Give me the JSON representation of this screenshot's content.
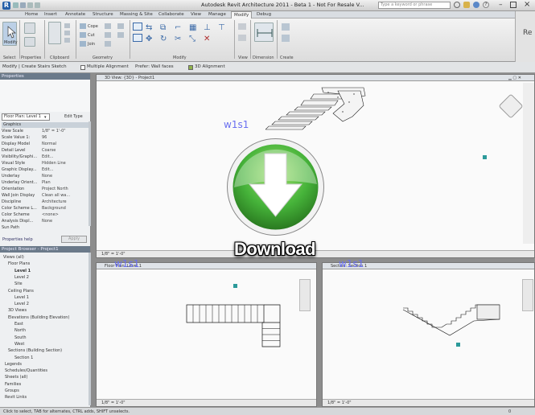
{
  "app": {
    "title": "Autodesk Revit Architecture 2011 - Beta 1 - Not For Resale V...",
    "search_placeholder": "Type a keyword or phrase",
    "right_button": "Re"
  },
  "tabs": [
    "Home",
    "Insert",
    "Annotate",
    "Structure",
    "Massing & Site",
    "Collaborate",
    "View",
    "Manage",
    "Modify",
    "Debug"
  ],
  "ribbon": {
    "panels": [
      "Select",
      "Properties",
      "Clipboard",
      "Geometry",
      "Modify",
      "View",
      "Dimension",
      "Create"
    ],
    "button_labels": [
      "Modify",
      "Cope",
      "Cut",
      "Join"
    ]
  },
  "optbar": {
    "items": [
      "Modify | Create Stairs Sketch",
      "Multiple Alignment",
      "Prefer: Wall faces",
      "3D Alignment"
    ]
  },
  "properties": {
    "header": "Properties",
    "type_selector": "Floor Plan: Level 1",
    "edit_type": "Edit Type",
    "section": "Graphics",
    "rows": [
      {
        "k": "View Scale",
        "v": "1/8\" = 1'-0\""
      },
      {
        "k": "Scale Value 1:",
        "v": "96"
      },
      {
        "k": "Display Model",
        "v": "Normal"
      },
      {
        "k": "Detail Level",
        "v": "Coarse"
      },
      {
        "k": "Visibility/Graphi...",
        "v": "Edit..."
      },
      {
        "k": "Visual Style",
        "v": "Hidden Line"
      },
      {
        "k": "Graphic Display...",
        "v": "Edit..."
      },
      {
        "k": "Underlay",
        "v": "None"
      },
      {
        "k": "Underlay Orient...",
        "v": "Plan"
      },
      {
        "k": "Orientation",
        "v": "Project North"
      },
      {
        "k": "Wall Join Display",
        "v": "Clean all wa..."
      },
      {
        "k": "Discipline",
        "v": "Architecture"
      },
      {
        "k": "Color Scheme L...",
        "v": "Background"
      },
      {
        "k": "Color Scheme",
        "v": "<none>"
      },
      {
        "k": "Analysis Displ...",
        "v": "None"
      },
      {
        "k": "Sun Path",
        "v": ""
      }
    ],
    "help_link": "Properties help",
    "apply": "Apply"
  },
  "browser": {
    "header": "Project Browser - Project1",
    "items": [
      "Views (all)",
      "Floor Plans",
      "Level 1",
      "Level 2",
      "Site",
      "Ceiling Plans",
      "Level 1",
      "Level 2",
      "3D Views",
      "Elevations (Building Elevation)",
      "East",
      "North",
      "South",
      "West",
      "Sections (Building Section)",
      "Section 1",
      "Legends",
      "Schedules/Quantities",
      "Sheets (all)",
      "Families",
      "Groups",
      "Revit Links"
    ]
  },
  "views": {
    "v3d": {
      "title": "3D View: {3D} - Project1",
      "scale": "1/8\" = 1'-0\""
    },
    "plan": {
      "title": "Floor Plan: Level 1",
      "scale": "1/8\" = 1'-0\""
    },
    "section": {
      "title": "Section: Section 1",
      "scale": "1/8\" = 1'-0\""
    }
  },
  "watermark": "w1s1",
  "download": {
    "label": "Download",
    "colors": {
      "green": "#46b33a",
      "dark_green": "#2a7a20"
    }
  },
  "status": {
    "text": "Click to select, TAB for alternates, CTRL adds, SHIFT unselects.",
    "right_value": "0"
  }
}
